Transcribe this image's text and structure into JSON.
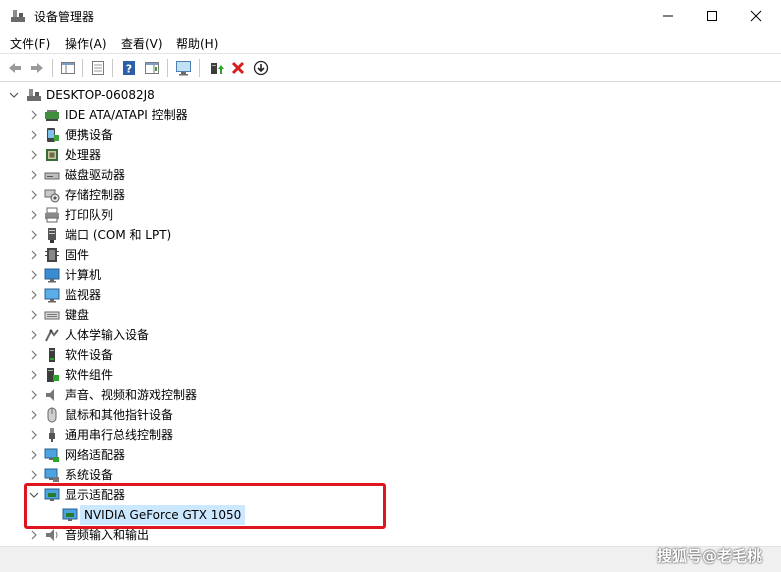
{
  "window": {
    "title": "设备管理器",
    "minimize_glyph": "—",
    "maximize_glyph": "☐",
    "close_glyph": "✕"
  },
  "menu": [
    "文件(F)",
    "操作(A)",
    "查看(V)",
    "帮助(H)"
  ],
  "toolbar": {
    "buttons": [
      "back-icon",
      "forward-icon",
      "properties-pane-icon",
      "list-icon",
      "help-icon",
      "action-pane-icon",
      "monitor-scan-icon",
      "update-driver-icon",
      "uninstall-icon",
      "download-icon"
    ]
  },
  "tree": {
    "root": "DESKTOP-06082J8",
    "categories": [
      {
        "label": "IDE ATA/ATAPI 控制器",
        "icon": "ide-controller-icon"
      },
      {
        "label": "便携设备",
        "icon": "portable-device-icon"
      },
      {
        "label": "处理器",
        "icon": "processor-icon"
      },
      {
        "label": "磁盘驱动器",
        "icon": "disk-drive-icon"
      },
      {
        "label": "存储控制器",
        "icon": "storage-controller-icon"
      },
      {
        "label": "打印队列",
        "icon": "printer-icon"
      },
      {
        "label": "端口 (COM 和 LPT)",
        "icon": "port-icon"
      },
      {
        "label": "固件",
        "icon": "firmware-icon"
      },
      {
        "label": "计算机",
        "icon": "computer-icon"
      },
      {
        "label": "监视器",
        "icon": "monitor-icon"
      },
      {
        "label": "键盘",
        "icon": "keyboard-icon"
      },
      {
        "label": "人体学输入设备",
        "icon": "hid-icon"
      },
      {
        "label": "软件设备",
        "icon": "software-device-icon"
      },
      {
        "label": "软件组件",
        "icon": "software-component-icon"
      },
      {
        "label": "声音、视频和游戏控制器",
        "icon": "sound-icon"
      },
      {
        "label": "鼠标和其他指针设备",
        "icon": "mouse-icon"
      },
      {
        "label": "通用串行总线控制器",
        "icon": "usb-icon"
      },
      {
        "label": "网络适配器",
        "icon": "network-adapter-icon"
      },
      {
        "label": "系统设备",
        "icon": "system-device-icon"
      },
      {
        "label": "显示适配器",
        "icon": "display-adapter-icon",
        "expanded": true
      },
      {
        "label": "音频输入和输出",
        "icon": "audio-io-icon"
      }
    ],
    "expanded_child": "NVIDIA GeForce GTX 1050"
  },
  "watermark": "搜狐号@老毛桃",
  "colors": {
    "highlight_border": "#e0141e",
    "selection_bg": "#cce8ff"
  }
}
